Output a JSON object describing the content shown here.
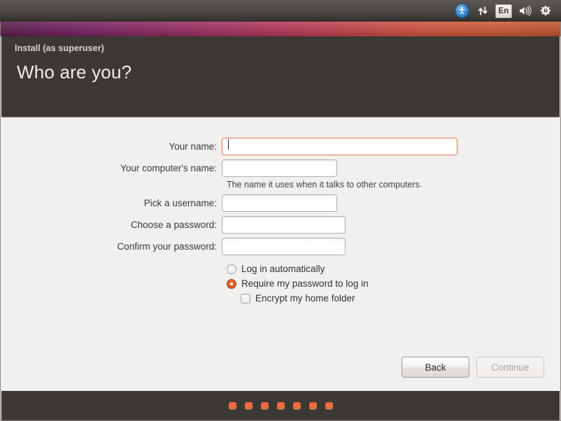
{
  "top_panel": {
    "icons": [
      {
        "name": "accessibility-icon",
        "glyph": "accessibility"
      },
      {
        "name": "network-icon",
        "glyph": "network-updown"
      },
      {
        "name": "keyboard-layout-indicator",
        "label": "En"
      },
      {
        "name": "volume-icon",
        "glyph": "speaker"
      },
      {
        "name": "session-power-icon",
        "glyph": "gear-power"
      }
    ]
  },
  "window": {
    "titlebar": "Install (as superuser)",
    "heading": "Who are you?"
  },
  "form": {
    "fields": [
      {
        "label": "Your name:",
        "value": "",
        "width_class": "w-name",
        "focused": true,
        "name": "your-name"
      },
      {
        "label": "Your computer's name:",
        "value": "",
        "width_class": "w-computer",
        "focused": false,
        "name": "computer-name"
      },
      {
        "label": "Pick a username:",
        "value": "",
        "width_class": "w-username",
        "focused": false,
        "name": "username"
      },
      {
        "label": "Choose a password:",
        "value": "",
        "width_class": "w-pass",
        "focused": false,
        "name": "password"
      },
      {
        "label": "Confirm your password:",
        "value": "",
        "width_class": "w-pass",
        "focused": false,
        "name": "confirm-password"
      }
    ],
    "computer_name_hint": "The name it uses when it talks to other computers.",
    "options": {
      "login_automatically": "Log in automatically",
      "require_password": "Require my password to log in",
      "encrypt_home": "Encrypt my home folder",
      "selected_login_mode": "require_password",
      "encrypt_home_checked": false
    }
  },
  "buttons": {
    "back": "Back",
    "continue": "Continue",
    "continue_disabled": true
  },
  "footer": {
    "progress_dots": 7
  },
  "colors": {
    "accent_orange": "#ec6b3f",
    "focus_border": "#e8906b",
    "dark_chrome": "#3c3833",
    "content_bg": "#f2f0ef",
    "panel_dark": "#403c39"
  }
}
